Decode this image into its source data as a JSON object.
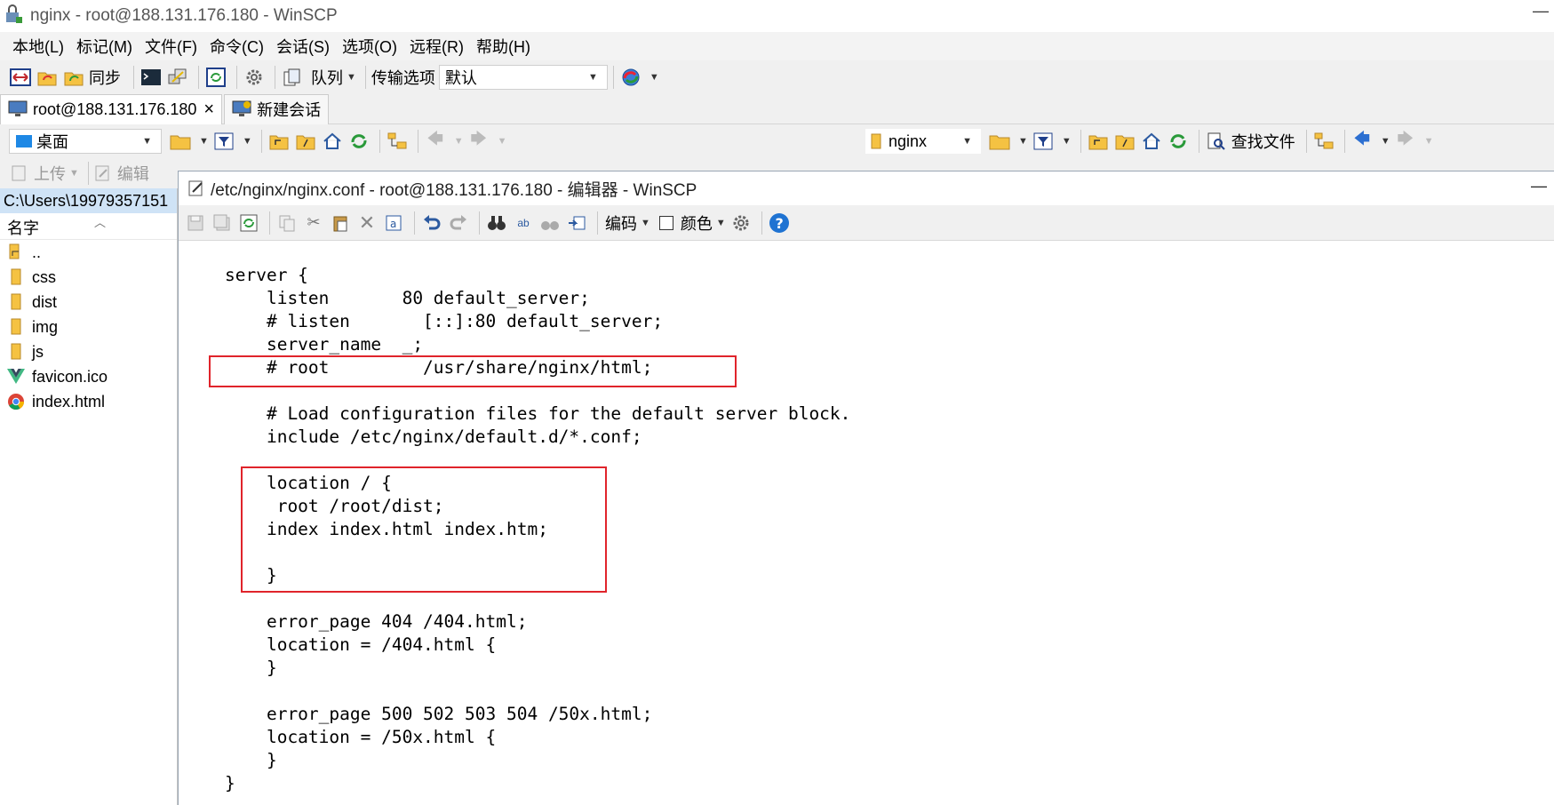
{
  "window": {
    "title": "nginx - root@188.131.176.180 - WinSCP"
  },
  "menu": {
    "items": [
      "本地(L)",
      "标记(M)",
      "文件(F)",
      "命令(C)",
      "会话(S)",
      "选项(O)",
      "远程(R)",
      "帮助(H)"
    ]
  },
  "toolbar": {
    "sync_label": "同步",
    "queue_label": "队列",
    "transfer_options_label": "传输选项",
    "transfer_preset": "默认"
  },
  "tabs": {
    "session_label": "root@188.131.176.180",
    "close_glyph": "×",
    "new_session_label": "新建会话"
  },
  "local_nav": {
    "location": "桌面"
  },
  "remote_nav": {
    "location": "nginx",
    "find_files_label": "查找文件"
  },
  "local_actions": {
    "upload_label": "上传",
    "edit_label": "编辑"
  },
  "local_panel": {
    "path": "C:\\Users\\19979357151",
    "column_name": "名字",
    "files": [
      {
        "name": "..",
        "icon": "parent-folder-icon"
      },
      {
        "name": "css",
        "icon": "folder-icon"
      },
      {
        "name": "dist",
        "icon": "folder-icon"
      },
      {
        "name": "img",
        "icon": "folder-icon"
      },
      {
        "name": "js",
        "icon": "folder-icon"
      },
      {
        "name": "favicon.ico",
        "icon": "vue-logo-icon"
      },
      {
        "name": "index.html",
        "icon": "chrome-icon"
      }
    ]
  },
  "editor": {
    "title": "/etc/nginx/nginx.conf - root@188.131.176.180 - 编辑器 - WinSCP",
    "encoding_label": "编码",
    "color_label": "颜色",
    "lines": [
      "server {",
      "    listen       80 default_server;",
      "    # listen       [::]:80 default_server;",
      "    server_name  _;",
      "    # root         /usr/share/nginx/html;",
      "",
      "    # Load configuration files for the default server block.",
      "    include /etc/nginx/default.d/*.conf;",
      "",
      "    location / {",
      "     root /root/dist;",
      "    index index.html index.htm;",
      "",
      "    }",
      "",
      "    error_page 404 /404.html;",
      "    location = /404.html {",
      "    }",
      "",
      "    error_page 500 502 503 504 /50x.html;",
      "    location = /50x.html {",
      "    }",
      "}"
    ]
  },
  "colors": {
    "highlight_red": "#e0242b",
    "path_bar": "#cfe3f6",
    "folder_yellow": "#f5c242",
    "help_blue": "#1f73d2"
  }
}
